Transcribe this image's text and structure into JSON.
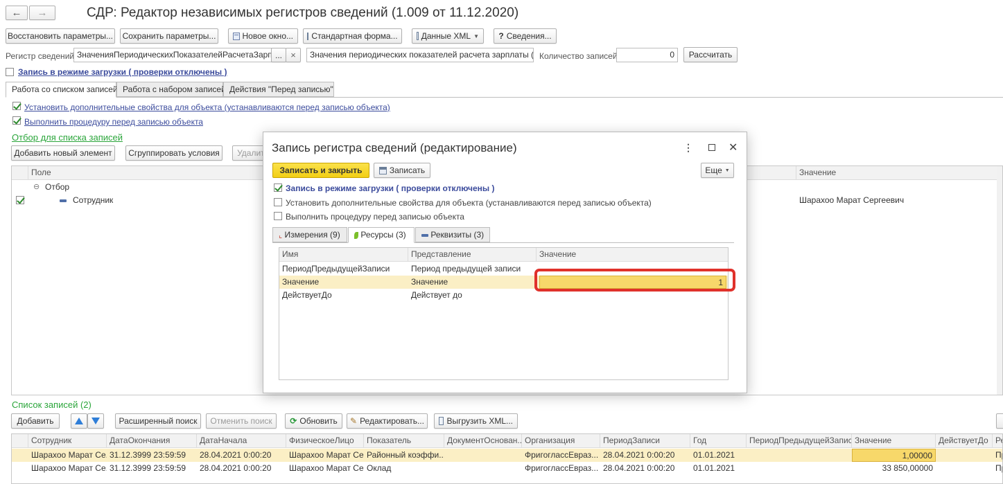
{
  "title": "СДР: Редактор независимых регистров сведений (1.009 от 11.12.2020)",
  "nav": {
    "back_icon": "arrow-left-icon",
    "forward_icon": "arrow-right-icon"
  },
  "toolbar": {
    "restore": "Восстановить параметры...",
    "save": "Сохранить параметры...",
    "new_window": "Новое окно...",
    "standard_form": "Стандартная форма...",
    "xml_data": "Данные XML",
    "info": "Сведения..."
  },
  "register": {
    "label": "Регистр сведений:",
    "value": "ЗначенияПериодическихПоказателейРасчетаЗарплаты",
    "select_btn": "...",
    "clear_btn": "×",
    "description": "Значения периодических показателей расчета зарплаты (для с",
    "count_label": "Количество записей:",
    "count_value": "0",
    "calc_btn": "Рассчитать"
  },
  "load_mode": {
    "label": "Запись в режиме загрузки ( проверки отключены )",
    "checked": false
  },
  "tabs": [
    "Работа со списком записей",
    "Работа с набором записей",
    "Действия \"Перед записью\""
  ],
  "options": {
    "set_props": "Установить дополнительные свойства для объекта (устанавливаются перед записью объекта)",
    "run_proc": "Выполнить процедуру перед записью объекта"
  },
  "filter": {
    "title": "Отбор для списка записей",
    "add_btn": "Добавить новый элемент",
    "group_btn": "Сгруппировать условия",
    "delete_btn": "Удалить",
    "col_field": "Поле",
    "col_value": "Значение",
    "group_label": "Отбор",
    "item_label": "Сотрудник",
    "item_value": "Шарахоо Марат Сергеевич"
  },
  "records": {
    "title": "Список записей (2)",
    "add_btn": "Добавить",
    "ext_search": "Расширенный поиск",
    "cancel_search": "Отменить поиск",
    "refresh": "Обновить",
    "edit": "Редактировать...",
    "export_xml": "Выгрузить XML...",
    "columns": [
      "Сотрудник",
      "ДатаОкончания",
      "ДатаНачала",
      "ФизическоеЛицо",
      "Показатель",
      "ДокументОснован...",
      "Организация",
      "ПериодЗаписи",
      "Год",
      "ПериодПредыдущейЗаписи",
      "Значение",
      "ДействуетДо",
      "Ре"
    ],
    "rows": [
      [
        "Шарахоо Марат Се...",
        "31.12.3999 23:59:59",
        "28.04.2021 0:00:20",
        "Шарахоо Марат Се...",
        "Районный коэффи...",
        "",
        "ФригоглассЕвраз...",
        "28.04.2021 0:00:20",
        "01.01.2021",
        "",
        "1,00000",
        "",
        "Пр"
      ],
      [
        "Шарахоо Марат Се...",
        "31.12.3999 23:59:59",
        "28.04.2021 0:00:20",
        "Шарахоо Марат Се...",
        "Оклад",
        "",
        "ФригоглассЕвраз...",
        "28.04.2021 0:00:20",
        "01.01.2021",
        "",
        "33 850,00000",
        "",
        "Пр"
      ]
    ]
  },
  "dialog": {
    "title": "Запись регистра сведений (редактирование)",
    "save_close": "Записать и закрыть",
    "save": "Записать",
    "more": "Еще",
    "load_mode": "Запись в режиме загрузки ( проверки отключены )",
    "set_props": "Установить дополнительные свойства для объекта (устанавливаются перед записью объекта)",
    "run_proc": "Выполнить процедуру перед записью объекта",
    "tabs": [
      "Измерения (9)",
      "Ресурсы (3)",
      "Реквизиты (3)"
    ],
    "columns": [
      "Имя",
      "Представление",
      "Значение"
    ],
    "rows": [
      [
        "ПериодПредыдущейЗаписи",
        "Период предыдущей записи",
        ""
      ],
      [
        "Значение",
        "Значение",
        "1"
      ],
      [
        "ДействуетДо",
        "Действует до",
        ""
      ]
    ],
    "highlight_color": "#e0312b"
  }
}
